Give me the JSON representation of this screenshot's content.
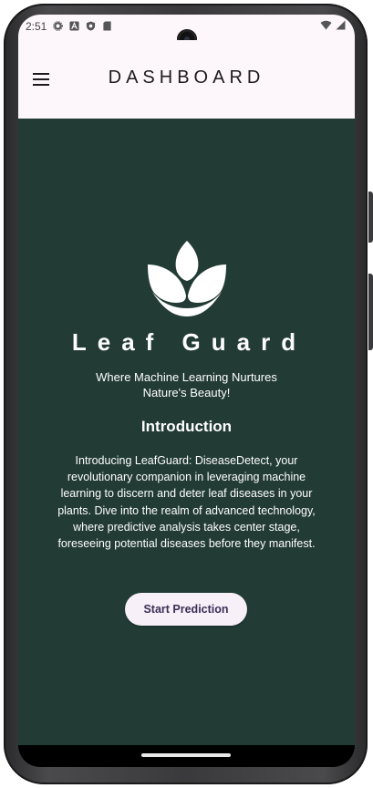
{
  "status_bar": {
    "time": "2:51",
    "left_icons": [
      "gear-icon",
      "text-a-icon",
      "shield-icon",
      "sd-card-icon"
    ],
    "right_icons": [
      "wifi-icon",
      "cellular-signal-icon"
    ]
  },
  "app_bar": {
    "title": "DASHBOARD",
    "menu_icon": "hamburger-menu-icon"
  },
  "hero": {
    "logo_icon": "leaf-lotus-icon",
    "brand_name": "Leaf Guard",
    "tagline": "Where Machine Learning Nurtures Nature's Beauty!"
  },
  "intro": {
    "heading": "Introduction",
    "body": "Introducing LeafGuard: DiseaseDetect, your revolutionary companion in leveraging machine learning to discern and deter leaf diseases in your plants. Dive into the realm of advanced technology, where predictive analysis takes center stage, foreseeing potential diseases before they manifest."
  },
  "actions": {
    "start_prediction_label": "Start Prediction"
  },
  "colors": {
    "background": "#223b35",
    "app_bar": "#fdf7fb",
    "button_bg": "#f7f0f8",
    "button_text": "#3b2f57",
    "text_primary": "#ffffff"
  }
}
